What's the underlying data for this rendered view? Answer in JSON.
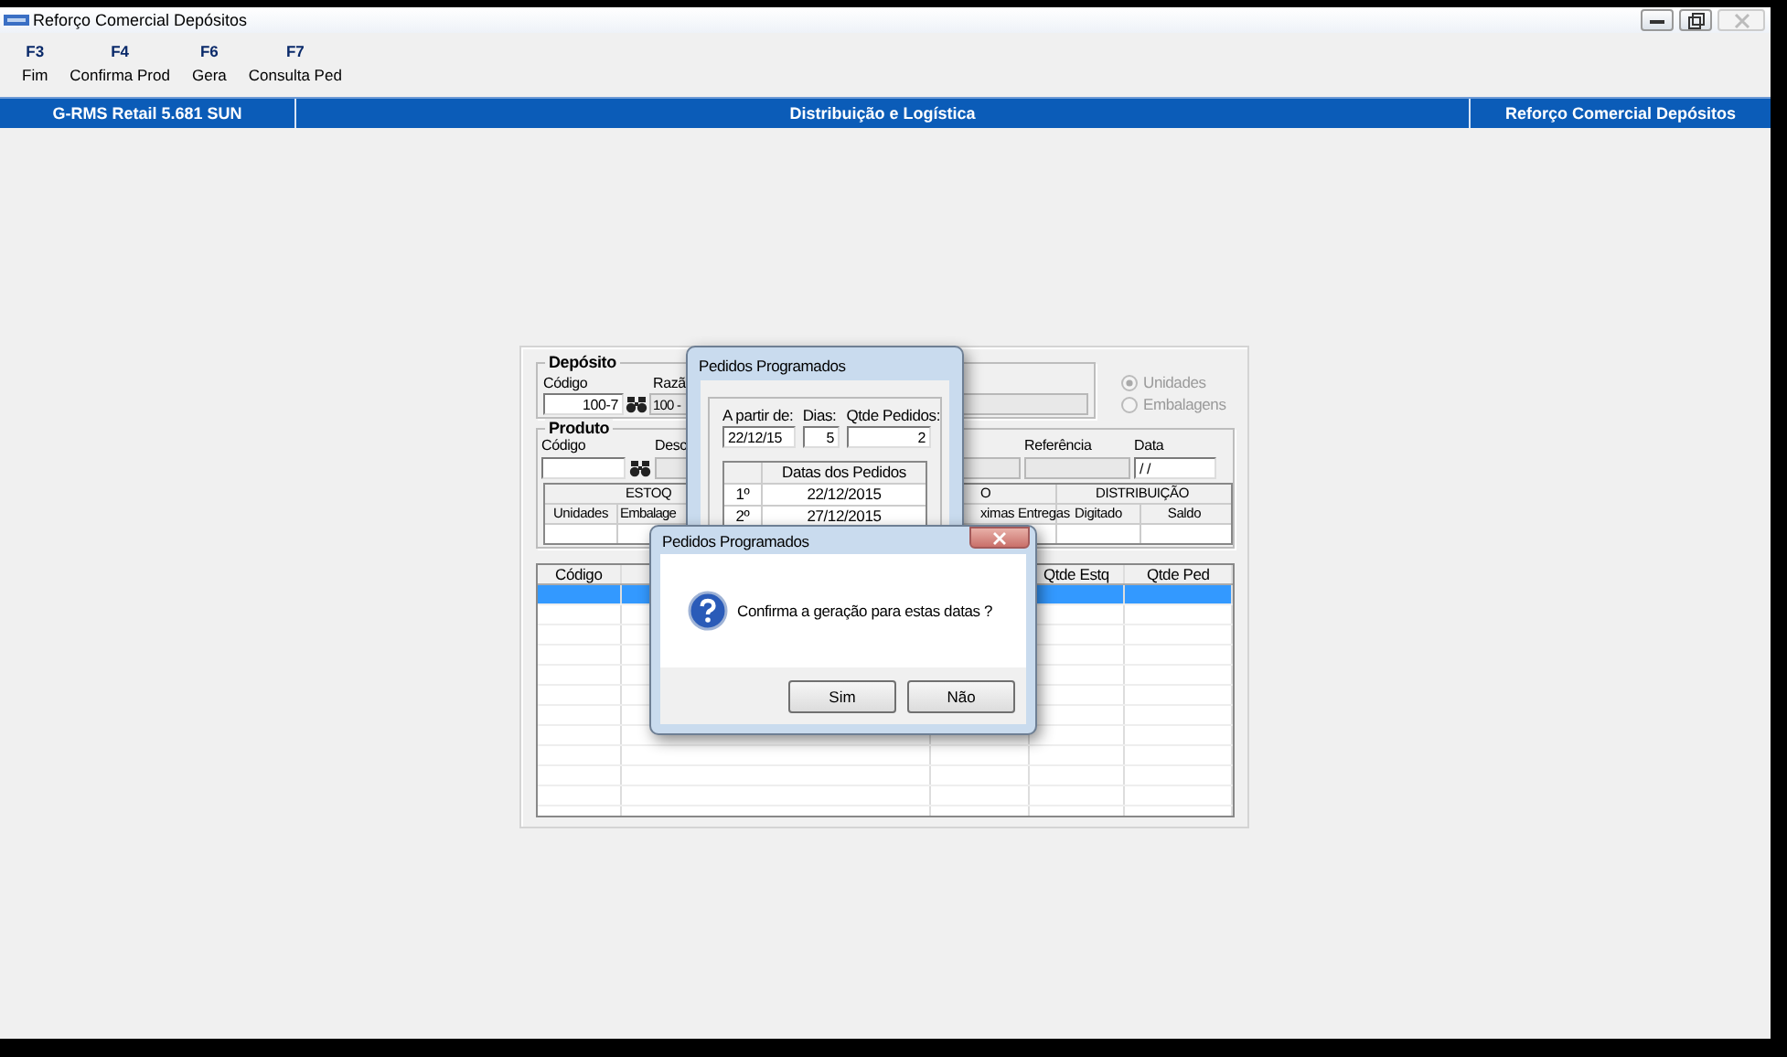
{
  "window": {
    "title": "Reforço Comercial Depósitos"
  },
  "toolbar": [
    {
      "key": "F3",
      "label": "Fim"
    },
    {
      "key": "F4",
      "label": "Confirma Prod"
    },
    {
      "key": "F6",
      "label": "Gera"
    },
    {
      "key": "F7",
      "label": "Consulta Ped"
    }
  ],
  "header_bar": {
    "left": "G-RMS Retail 5.681 SUN",
    "center": "Distribuição e Logística",
    "right": "Reforço Comercial Depósitos"
  },
  "deposito": {
    "title": "Depósito",
    "code_label": "Código",
    "code_value": "100-7",
    "name_label": "Razã",
    "name_value": "100 -"
  },
  "unit_options": {
    "disabled": true,
    "items": [
      {
        "label": "Unidades",
        "selected": true
      },
      {
        "label": "Embalagens",
        "selected": false
      }
    ]
  },
  "produto": {
    "title": "Produto",
    "code_label": "Código",
    "desc_label": "Desc",
    "ref_label": "Referência",
    "date_label": "Data",
    "date_value": " / /"
  },
  "stock_table": {
    "group_headers": [
      "ESTOQ",
      "O",
      "DISTRIBUIÇÃO"
    ],
    "columns": [
      "Unidades",
      "Embalage",
      "ximas Entregas",
      "Digitado",
      "Saldo"
    ]
  },
  "grid": {
    "columns": [
      "Código",
      "Qtde Estq",
      "Qtde Ped"
    ],
    "rows": [
      {
        "selected": true
      },
      {
        "selected": false
      },
      {
        "selected": false
      },
      {
        "selected": false
      },
      {
        "selected": false
      },
      {
        "selected": false
      },
      {
        "selected": false
      },
      {
        "selected": false
      },
      {
        "selected": false
      },
      {
        "selected": false
      },
      {
        "selected": false
      },
      {
        "selected": false
      }
    ]
  },
  "schedule_dialog": {
    "title": "Pedidos Programados",
    "start_label": "A partir de:",
    "start_value": "22/12/15",
    "days_label": "Dias:",
    "days_value": "5",
    "count_label": "Qtde Pedidos:",
    "count_value": "2",
    "dates_header": "Datas dos Pedidos",
    "dates": [
      {
        "ordinal": "1º",
        "date": "22/12/2015"
      },
      {
        "ordinal": "2º",
        "date": "27/12/2015"
      }
    ]
  },
  "confirm_dialog": {
    "title": "Pedidos Programados",
    "message": "Confirma a geração para estas datas ?",
    "buttons": [
      "Sim",
      "Não"
    ]
  }
}
